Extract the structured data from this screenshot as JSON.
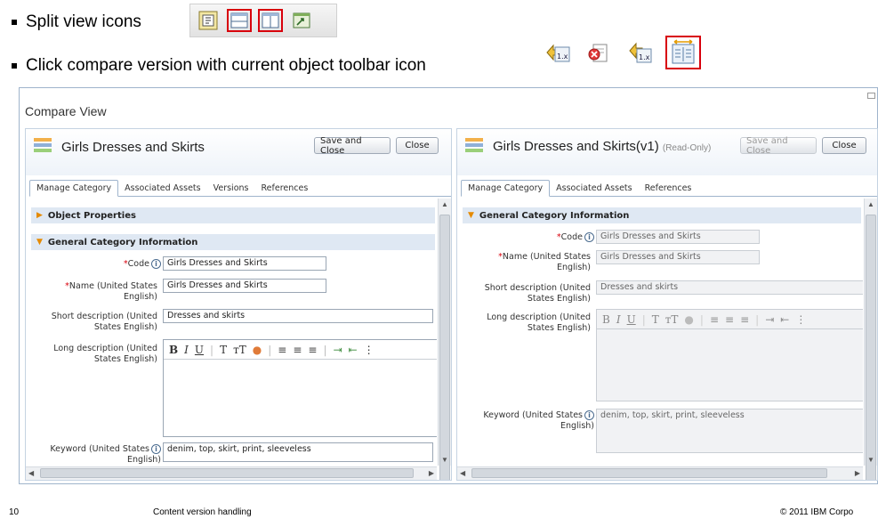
{
  "slide": {
    "bullet1": "Split view icons",
    "bullet2": "Click compare version with current object toolbar icon",
    "compare_icon_label": "1.x",
    "footer_page": "10",
    "footer_title": "Content version handling",
    "footer_copyright": "© 2011 IBM Corpo"
  },
  "window": {
    "title": "Compare View"
  },
  "left": {
    "title": "Girls Dresses and Skirts",
    "save_close": "Save and Close",
    "close": "Close",
    "tabs": [
      "Manage Category",
      "Associated Assets",
      "Versions",
      "References"
    ],
    "sections": {
      "object_props": "Object Properties",
      "general": "General Category Information"
    },
    "labels": {
      "code": "Code",
      "name_a": "Name (United States",
      "name_b": "English)",
      "short_a": "Short description (United",
      "short_b": "States English)",
      "long_a": "Long description (United",
      "long_b": "States English)",
      "keyword_a": "Keyword (United States",
      "keyword_b": "English)"
    },
    "values": {
      "code": "Girls Dresses and Skirts",
      "name": "Girls Dresses and Skirts",
      "short": "Dresses and skirts",
      "keyword": "denim, top, skirt, print, sleeveless"
    }
  },
  "right": {
    "title": "Girls Dresses and Skirts(v1)",
    "readonly": "(Read-Only)",
    "save_close": "Save and Close",
    "close": "Close",
    "tabs": [
      "Manage Category",
      "Associated Assets",
      "References"
    ],
    "sections": {
      "general": "General Category Information"
    },
    "labels": {
      "code": "Code",
      "name_a": "Name (United States",
      "name_b": "English)",
      "short_a": "Short description (United",
      "short_b": "States English)",
      "long_a": "Long description (United",
      "long_b": "States English)",
      "keyword_a": "Keyword (United States",
      "keyword_b": "English)"
    },
    "values": {
      "code": "Girls Dresses and Skirts",
      "name": "Girls Dresses and Skirts",
      "short": "Dresses and skirts",
      "keyword": "denim, top, skirt, print, sleeveless"
    }
  },
  "rte_toolbar": {
    "bold": "B",
    "italic": "I",
    "underline": "U",
    "text": "T",
    "text_size": "тT"
  },
  "info_glyph": "i",
  "required_marker": "*"
}
